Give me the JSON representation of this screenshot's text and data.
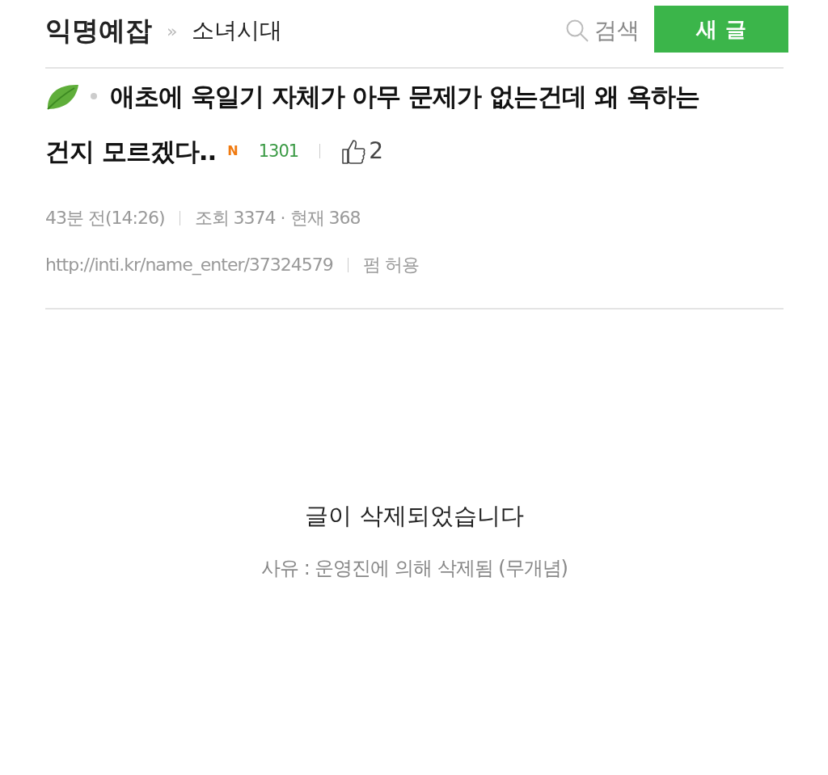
{
  "header": {
    "board": "익명예잡",
    "separator": "»",
    "category": "소녀시대",
    "search_label": "검색",
    "new_post_button": "새 글"
  },
  "post": {
    "title_lines": [
      "애초에 욱일기 자체가 아무 문제가 없는건데 왜 욕하는",
      "건지 모르겠다.."
    ],
    "new_badge": "N",
    "comment_count": "1301",
    "likes": "2",
    "time": "43분 전(14:26)",
    "views": "조회 3374 · 현재 368",
    "url": "http://inti.kr/name_enter/37324579",
    "permission": "펌 허용"
  },
  "notice": {
    "message": "글이 삭제되었습니다",
    "reason": "사유 : 운영진에 의해 삭제됨 (무개념)"
  }
}
